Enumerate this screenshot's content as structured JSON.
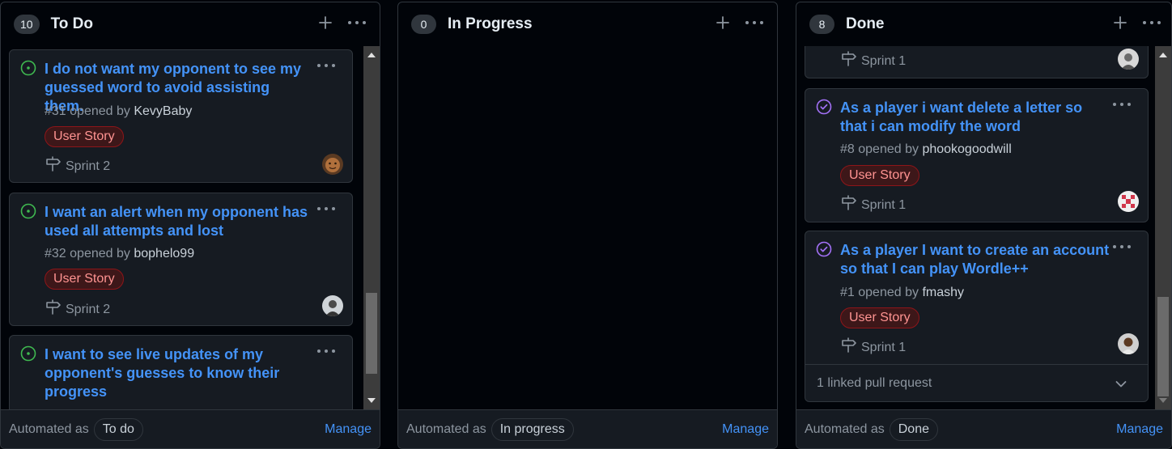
{
  "columns": [
    {
      "count": "10",
      "title": "To Do",
      "footer": {
        "automated": "Automated as",
        "pill": "To do",
        "manage": "Manage"
      },
      "cards": [
        {
          "title": "I do not want my opponent to see my guessed word to avoid assisting them.",
          "number": "#31",
          "opened_by": "opened by",
          "author": "KevyBaby",
          "label": "User Story",
          "sprint": "Sprint 2"
        },
        {
          "title": "I want an alert when my opponent has used all attempts and lost",
          "number": "#32",
          "opened_by": "opened by",
          "author": "bophelo99",
          "label": "User Story",
          "sprint": "Sprint 2"
        },
        {
          "title": "I want to see live updates of my opponent's guesses to know their progress"
        }
      ]
    },
    {
      "count": "0",
      "title": "In Progress",
      "footer": {
        "automated": "Automated as",
        "pill": "In progress",
        "manage": "Manage"
      }
    },
    {
      "count": "8",
      "title": "Done",
      "footer": {
        "automated": "Automated as",
        "pill": "Done",
        "manage": "Manage"
      },
      "cards": [
        {
          "sprint": "Sprint 1"
        },
        {
          "title": "As a player i want delete a letter so that i can modify the word",
          "number": "#8",
          "opened_by": "opened by",
          "author": "phookogoodwill",
          "label": "User Story",
          "sprint": "Sprint 1"
        },
        {
          "title": "As a player I want to create an account so that I can play Wordle++",
          "number": "#1",
          "opened_by": "opened by",
          "author": "fmashy",
          "label": "User Story",
          "sprint": "Sprint 1",
          "linked": "1 linked pull request"
        }
      ]
    }
  ],
  "colors": {
    "open_issue": "#3fb950",
    "closed_issue": "#a371f7",
    "link": "#4493f8",
    "label_text": "#ff9492"
  },
  "icons": [
    "plus-icon",
    "kebab-icon",
    "issue-open-icon",
    "issue-closed-icon",
    "milestone-icon",
    "chevron-down-icon"
  ]
}
